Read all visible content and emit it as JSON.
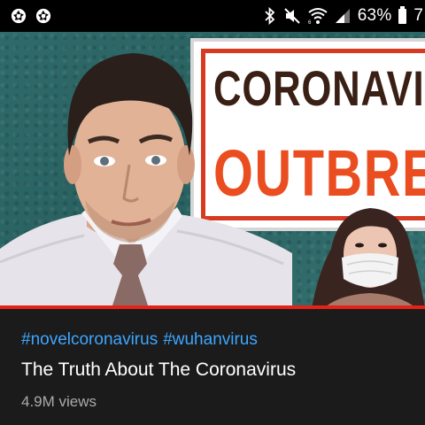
{
  "status_bar": {
    "left_icons": [
      "aperture-icon",
      "aperture-icon"
    ],
    "right_icons": [
      "bluetooth-icon",
      "mute-icon",
      "wifi-icon",
      "signal-icon"
    ],
    "battery_percent": "63%",
    "clock_partial": "7"
  },
  "thumbnail": {
    "sign_line1": "CORONAVIRU",
    "sign_line2": "OUTBREA",
    "colors": {
      "sign_text_dark": "#3a1f14",
      "sign_text_orange": "#ea4d1f",
      "sign_border": "#d63a21",
      "background_teal": "#2f6b6b"
    },
    "progress_bar_color": "#e62117"
  },
  "video": {
    "hashtags": [
      "#novelcoronavirus",
      "#wuhanvirus"
    ],
    "title": "The Truth About The Coronavirus",
    "views": "4.9M views",
    "colors": {
      "hashtag": "#3ea6ff",
      "title": "#ffffff",
      "views": "#aaaaaa"
    }
  }
}
